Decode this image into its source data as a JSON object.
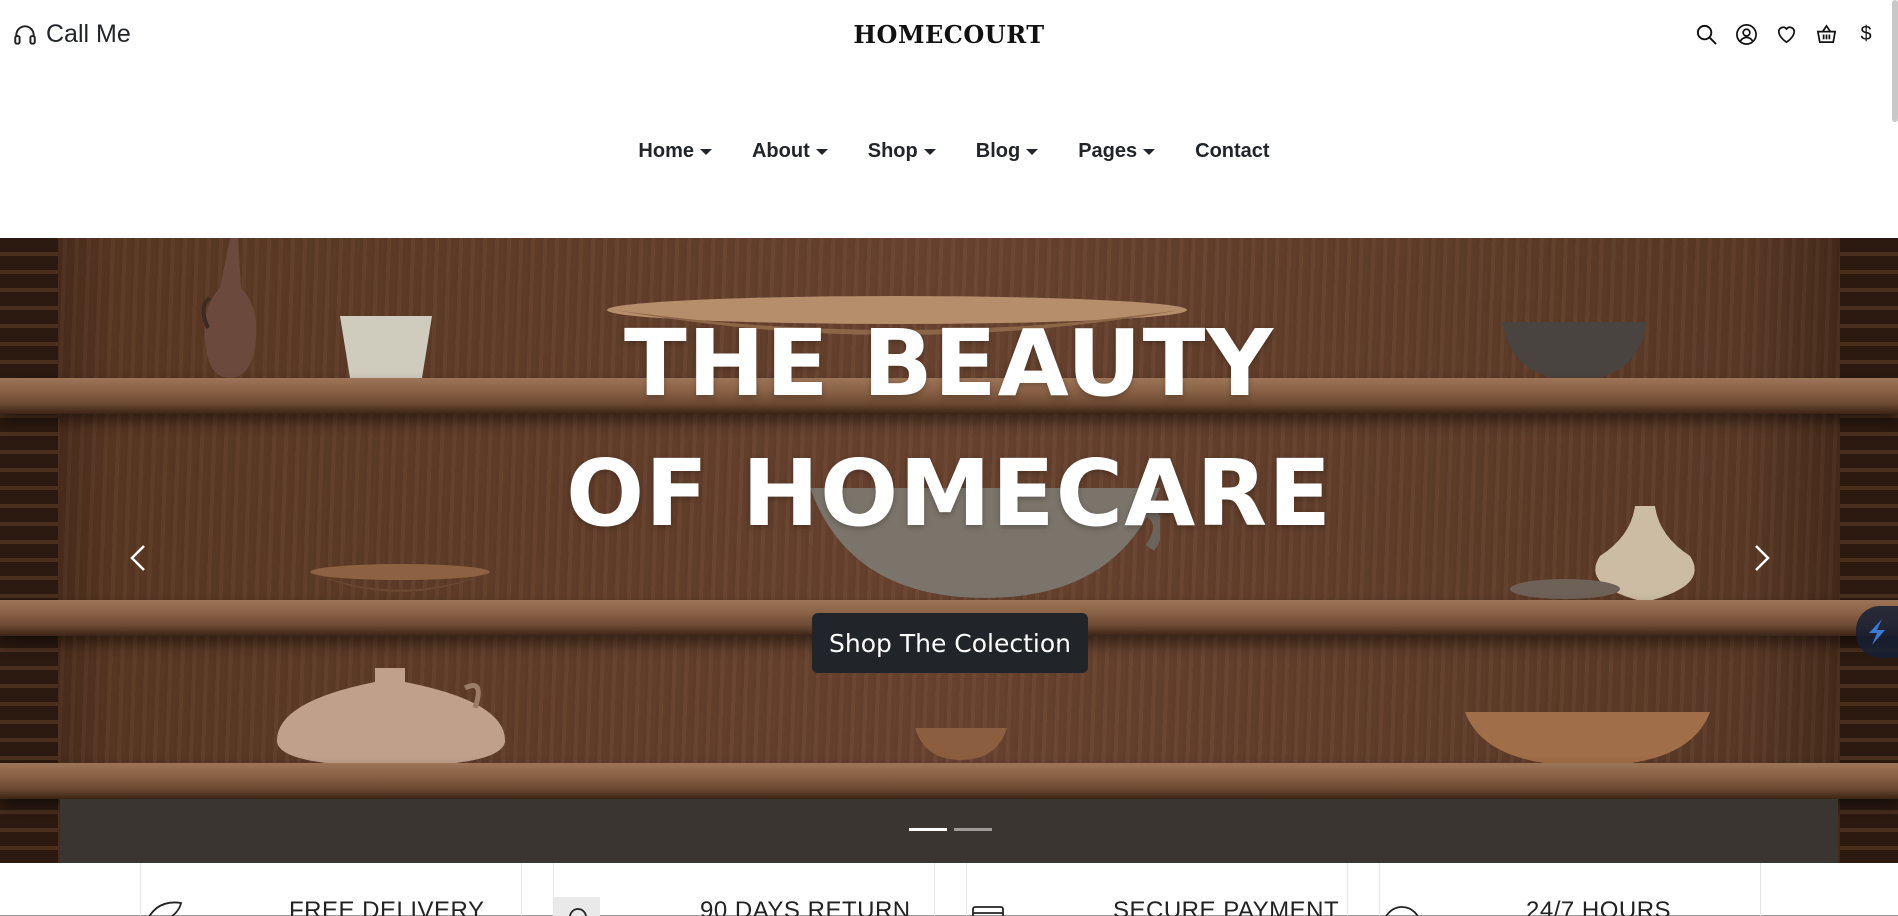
{
  "header": {
    "call_label": "Call Me",
    "brand": "HOMECOURT",
    "currency": "$",
    "icons": [
      "headset-icon",
      "search-icon",
      "user-icon",
      "heart-icon",
      "basket-icon"
    ]
  },
  "nav": {
    "items": [
      {
        "label": "Home",
        "dropdown": true
      },
      {
        "label": "About",
        "dropdown": true
      },
      {
        "label": "Shop",
        "dropdown": true
      },
      {
        "label": "Blog",
        "dropdown": true
      },
      {
        "label": "Pages",
        "dropdown": true
      },
      {
        "label": "Contact",
        "dropdown": false
      }
    ]
  },
  "hero": {
    "title_line1": "THE BEAUTY",
    "title_line2": "OF HOMECARE",
    "cta_label": "Shop The Colection",
    "slide_count": 2,
    "active_slide": 1
  },
  "features": [
    {
      "label": "FREE DELIVERY",
      "icon": "rocket-icon"
    },
    {
      "label": "90 DAYS RETURN",
      "icon": "return-box-icon"
    },
    {
      "label": "SECURE PAYMENT",
      "icon": "credit-card-icon"
    },
    {
      "label": "24/7 HOURS",
      "icon": "support-icon"
    }
  ],
  "colors": {
    "text": "#212529",
    "cta_bg": "#212529",
    "hero_wood": "#6a4430",
    "white": "#ffffff"
  }
}
